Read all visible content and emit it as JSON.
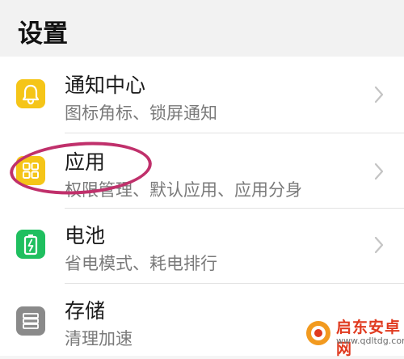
{
  "header": {
    "title": "设置"
  },
  "items": [
    {
      "label": "通知中心",
      "sub": "图标角标、锁屏通知",
      "icon": "notification-bell-icon",
      "color": "#f5c518"
    },
    {
      "label": "应用",
      "sub": "权限管理、默认应用、应用分身",
      "icon": "apps-grid-icon",
      "color": "#f5c518"
    },
    {
      "label": "电池",
      "sub": "省电模式、耗电排行",
      "icon": "battery-icon",
      "color": "#1fbf5f"
    },
    {
      "label": "存储",
      "sub": "清理加速",
      "icon": "storage-icon",
      "color": "#8a8a8a"
    }
  ],
  "watermark": {
    "title": "启东安卓网",
    "url": "www.qdltdg.com"
  },
  "annotation_color": "#c0306b"
}
